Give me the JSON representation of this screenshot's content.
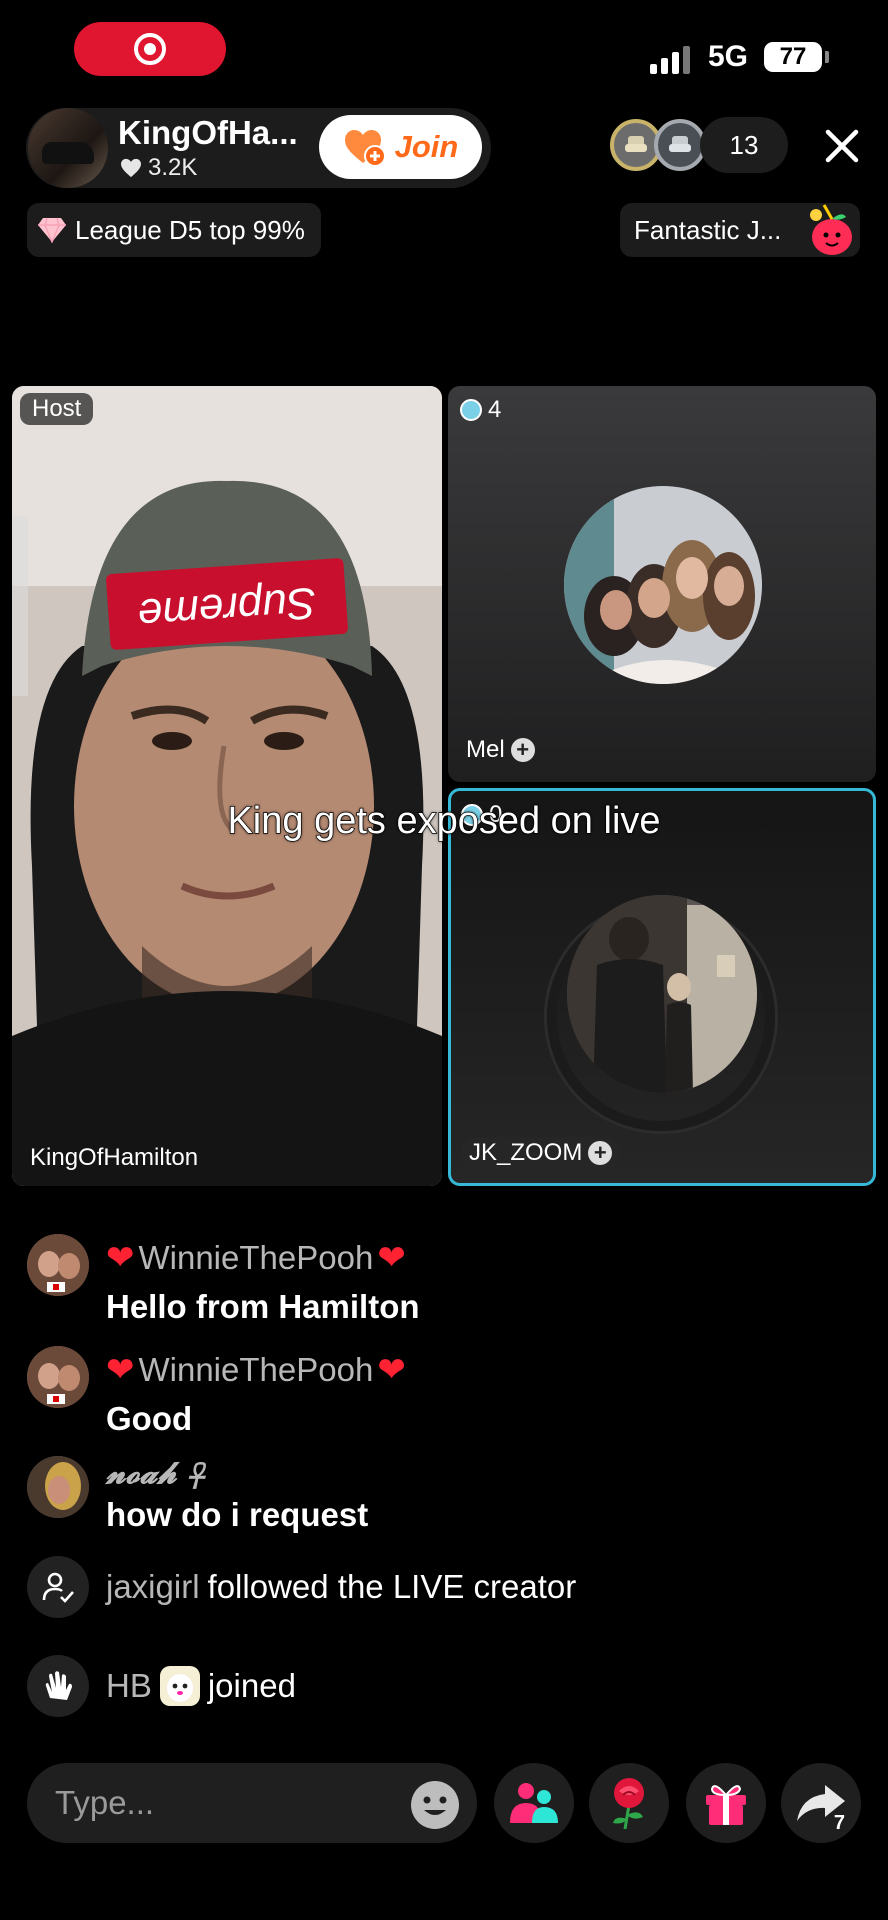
{
  "status_bar": {
    "network": "5G",
    "battery": "77",
    "recording_indicator": "screen-record-icon"
  },
  "host": {
    "name": "KingOfHa...",
    "likes": "3.2K",
    "join_label": "Join",
    "viewer_count": "13",
    "league": "League D5 top 99%",
    "event_chip": "Fantastic J..."
  },
  "video_grid": {
    "host_tag": "Host",
    "host_label": "KingOfHamilton",
    "guest1": {
      "badge": "4",
      "label": "Mel"
    },
    "guest2": {
      "badge": "0",
      "label": "JK_ZOOM"
    },
    "overlay_caption": "King gets exposed on live"
  },
  "chat": {
    "messages": [
      {
        "user": "WinnieThePooh",
        "text": "Hello from Hamilton"
      },
      {
        "user": "WinnieThePooh",
        "text": "Good"
      },
      {
        "user": "𝓷𝓸𝓪𝓱 ☥",
        "text": "how do i request"
      }
    ],
    "events": [
      {
        "user": "jaxigirl",
        "text": "followed the LIVE creator",
        "icon": "user-check-icon"
      },
      {
        "user": "HB",
        "text": "joined",
        "icon": "wave-hand-icon"
      }
    ]
  },
  "bottom_bar": {
    "input_placeholder": "Type...",
    "share_count": "7"
  },
  "colors": {
    "accent_red": "#e0152f",
    "join_orange": "#ff6a1a",
    "active_border": "#35b9d6",
    "pink": "#ff2d78"
  }
}
